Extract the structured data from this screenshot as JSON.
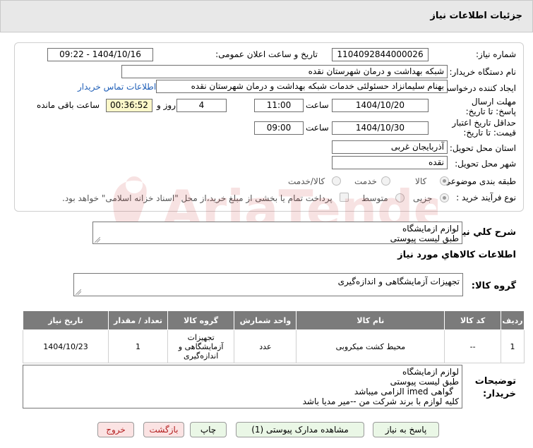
{
  "header": {
    "title": "جزئیات اطلاعات نیاز"
  },
  "labels": {
    "need_number": "شماره نیاز:",
    "announce_date": "تاریخ و ساعت اعلان عمومی:",
    "buyer_org": "نام دستگاه خریدار:",
    "requester": "ایجاد کننده درخواست:",
    "deadline_send": "مهلت ارسال پاسخ: تا تاریخ:",
    "time": "ساعت",
    "day_and": "روز و",
    "remaining": "ساعت باقی مانده",
    "min_validity": "حداقل تاریخ اعتبار قیمت: تا تاریخ:",
    "province": "استان محل تحویل:",
    "city": "شهر محل تحویل:",
    "category": "طبقه بندی موضوعی:",
    "process": "نوع فرآیند خرید :",
    "need_desc": "شرح کلي نياز:",
    "goods_info": "اطلاعات کالاهاي مورد نياز",
    "goods_group": "گروه کالا:",
    "buyer_notes": "توضیحات خریدار:"
  },
  "values": {
    "need_number": "1104092844000026",
    "announce_date": "1404/10/16 - 09:22",
    "buyer_org": "شبکه بهداشت و درمان شهرستان نقده",
    "requester": "بهنام سلیمانزاد حسئولئی خدمات شبکه بهداشت و درمان شهرستان نقده",
    "contact_link": "اطلاعات تماس خریدار",
    "deadline_date": "1404/10/20",
    "deadline_time": "11:00",
    "days": "4",
    "remaining": "00:36:52",
    "validity_date": "1404/10/30",
    "validity_time": "09:00",
    "province": "آذربایجان غربی",
    "city": "نقده"
  },
  "category_options": [
    {
      "label": "کالا",
      "selected": true
    },
    {
      "label": "خدمت",
      "selected": false
    },
    {
      "label": "کالا/خدمت",
      "selected": false
    }
  ],
  "process_options": [
    {
      "label": "جزیی",
      "selected": true
    },
    {
      "label": "متوسط",
      "selected": false
    }
  ],
  "payment_note": "پرداخت تمام یا بخشی از مبلغ خرید،از محل \"اسناد خزانه اسلامی\" خواهد بود.",
  "need_desc": {
    "line1": "لوازم ازمایشگاه",
    "line2": "طبق لیست پیوستی"
  },
  "goods_group_value": "تجهیزات آزمایشگاهی و اندازه‌گیری",
  "table": {
    "headers": [
      "ردیف",
      "کد کالا",
      "نام کالا",
      "واحد شمارش",
      "گروه کالا",
      "تعداد / مقدار",
      "تاریخ نیاز"
    ],
    "rows": [
      {
        "row": "1",
        "code": "--",
        "name": "محیط کشت میکروبی",
        "unit": "عدد",
        "group": "تجهیزات آزمایشگاهی و اندازه‌گیری",
        "qty": "1",
        "date": "1404/10/23"
      }
    ]
  },
  "buyer_notes": {
    "line1": "لوازم ازمایشگاه",
    "line2": "طبق لیست پیوستی",
    "line3": "گواهی imed الزامی میباشد",
    "line4": "کلیه لوازم با برند شرکت من --میر مدیا  باشد"
  },
  "buttons": {
    "reply": "پاسخ به نیاز",
    "docs": "مشاهده مدارک پیوستی (1)",
    "print": "چاپ",
    "back": "بازگشت",
    "exit": "خروج"
  },
  "watermark_text": "AriaTender.net",
  "colors": {
    "header_bg": "#e8e8e8",
    "table_header": "#7b7b7b",
    "highlight": "#fbf7c9",
    "link": "#1f5fb8",
    "green_btn": "#eaf7e6",
    "red_btn": "#fbe3e3"
  }
}
